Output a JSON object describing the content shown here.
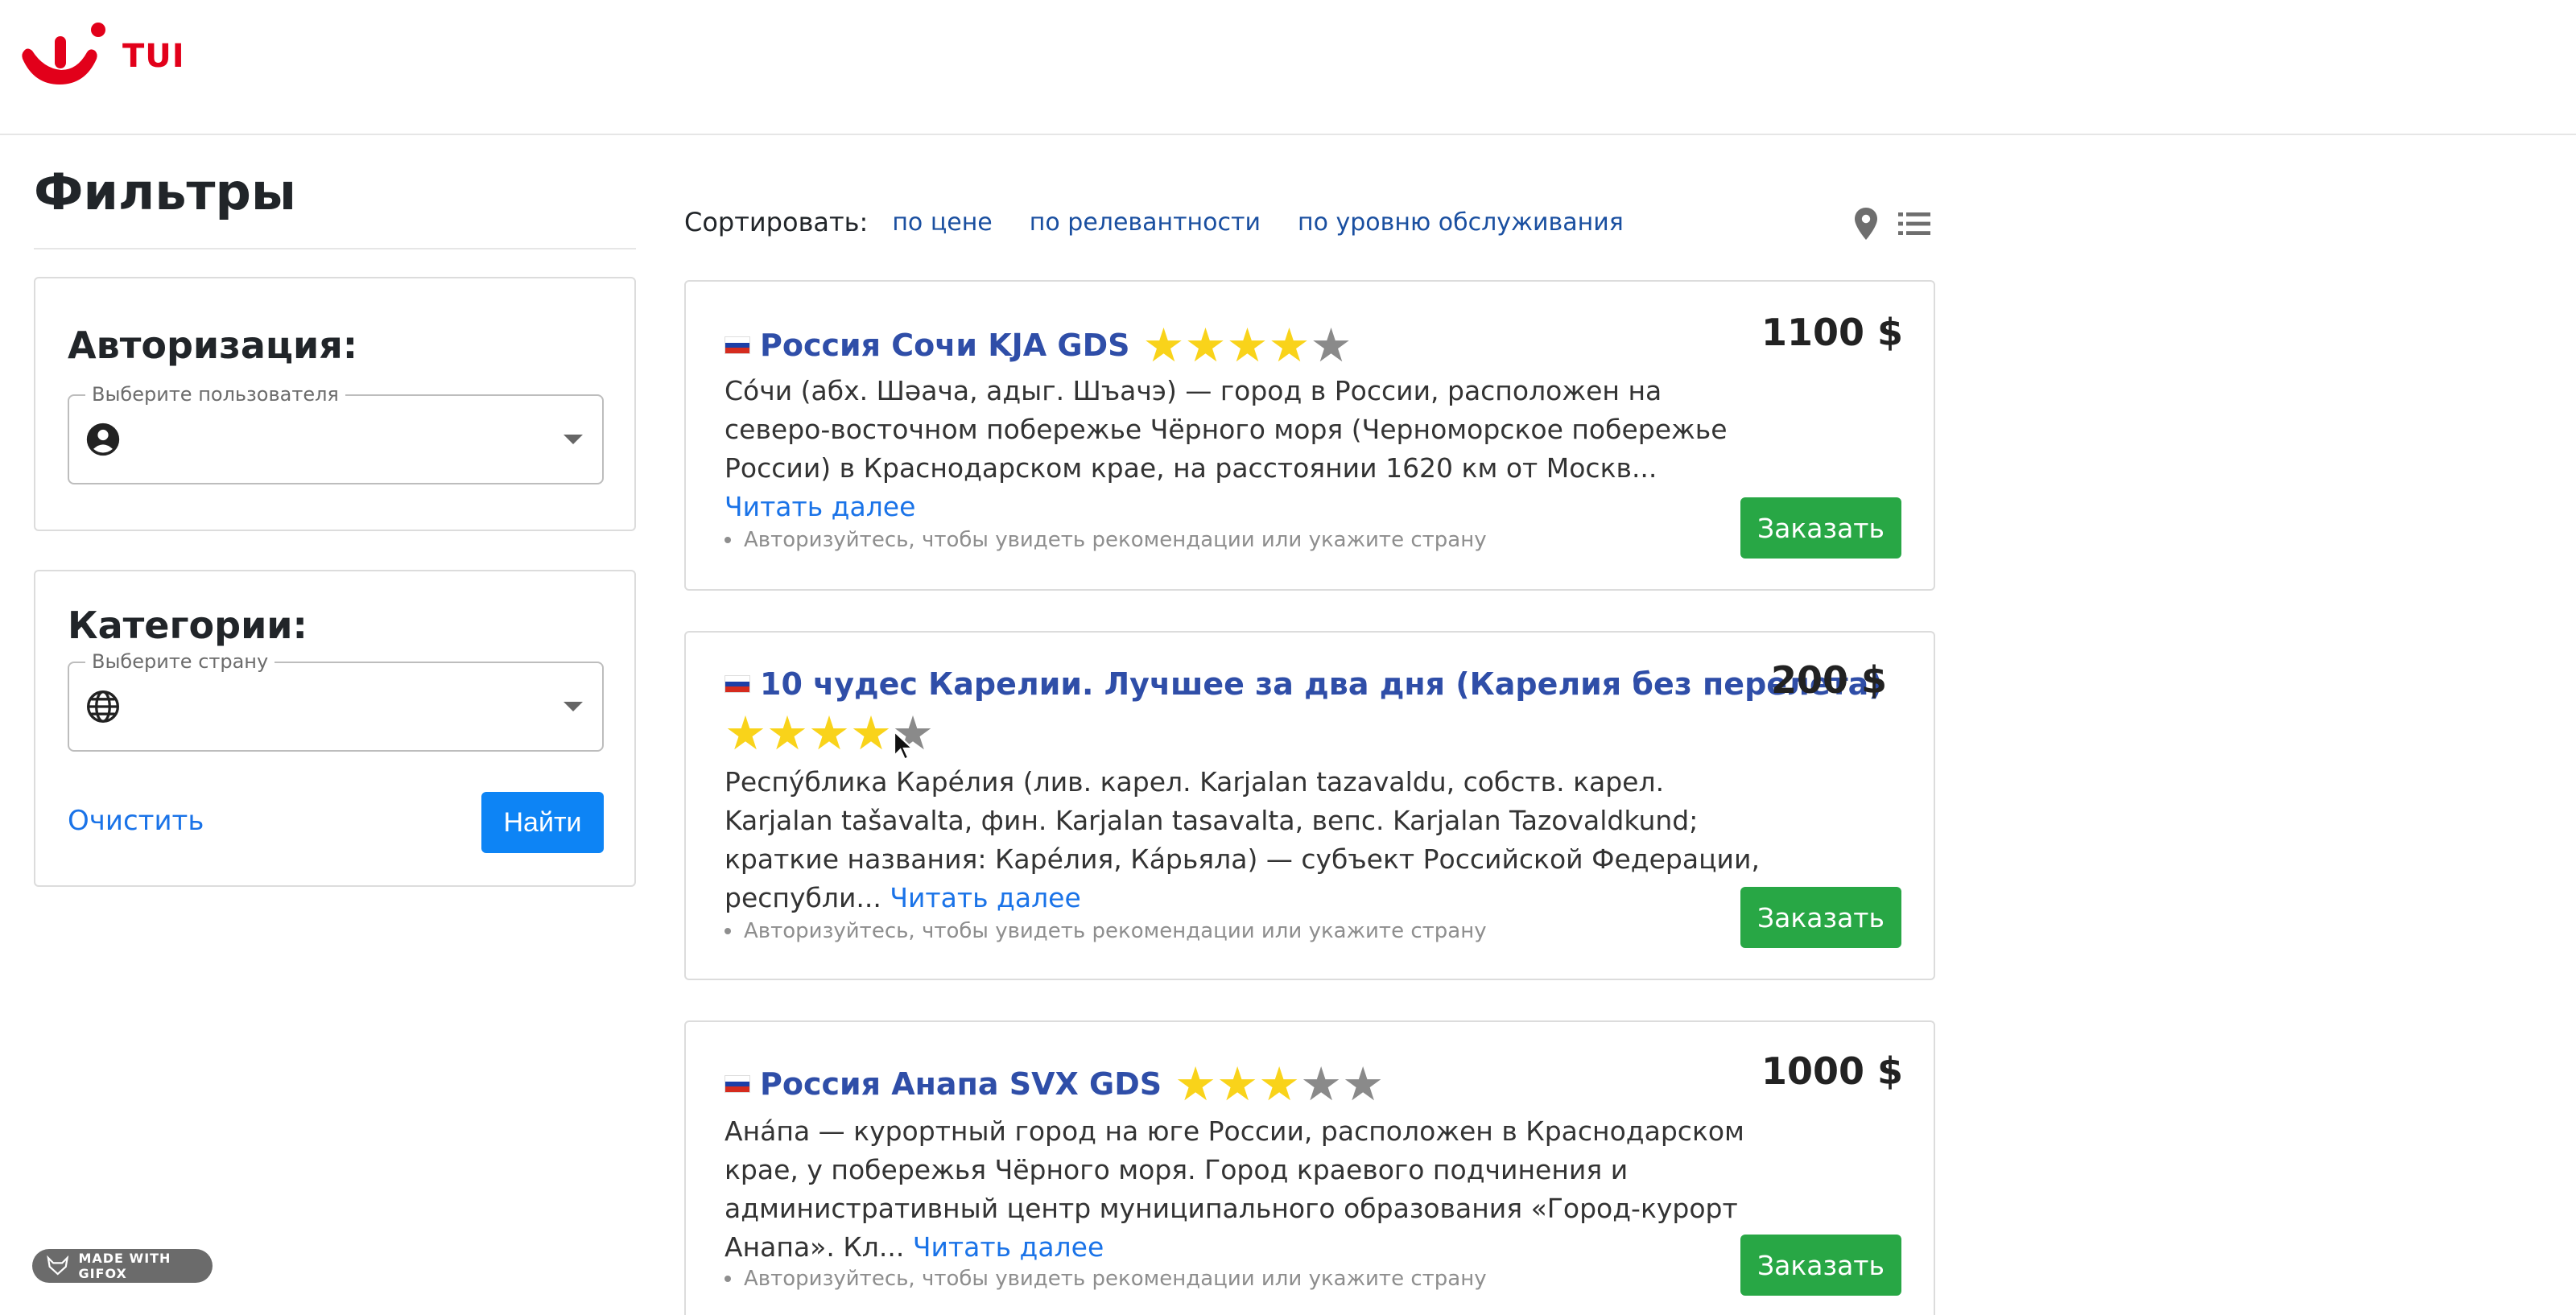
{
  "brand": {
    "logo_text": "TUI",
    "color": "#e2001a"
  },
  "filters": {
    "title": "Фильтры",
    "auth": {
      "heading": "Авторизация:",
      "select_label": "Выберите пользователя",
      "icon": "account-circle-icon"
    },
    "categories": {
      "heading": "Категории:",
      "select_label": "Выберите страну",
      "icon": "globe-icon"
    },
    "clear_label": "Очистить",
    "find_label": "Найти"
  },
  "sort": {
    "label": "Сортировать:",
    "options": [
      "по цене",
      "по релевантности",
      "по уровню обслуживания"
    ],
    "view_icons": [
      "map-pin-icon",
      "list-view-icon"
    ]
  },
  "tours": [
    {
      "title": "Россия Сочи KJA GDS",
      "rating": 4,
      "rating_max": 5,
      "price": "1100 $",
      "description": "Со́чи (абх. Шәача, адыг. Шъачэ) — город в России, расположен на северо-восточном побережье Чёрного моря (Черноморское побережье России) в Краснодарском крае, на расстоянии 1620 км от Москв...",
      "read_more": "Читать далее",
      "hint": "Авторизуйтесь, чтобы увидеть рекомендации или укажите страну",
      "order_label": "Заказать"
    },
    {
      "title": "10 чудес Карелии. Лучшее за два дня (Карелия без перелета)",
      "rating": 4,
      "rating_max": 5,
      "price": "200 $",
      "description": "Респу́блика Каре́лия (лив. карел. Karjalan tazavaldu, собств. карел. Karjalan tašavalta, фин. Karjalan tasavalta, вепс. Karjalan Tazovaldkund; краткие названия: Каре́лия, Ка́рьяла) — субъект Российской Федерации, республи...",
      "read_more": "Читать далее",
      "hint": "Авторизуйтесь, чтобы увидеть рекомендации или укажите страну",
      "order_label": "Заказать"
    },
    {
      "title": "Россия Анапа SVX GDS",
      "rating": 3,
      "rating_max": 5,
      "price": "1000 $",
      "description": "Ана́па — курортный город на юге России, расположен в Краснодарском крае, у побережья Чёрного моря. Город краевого подчинения и административный центр муниципального образования «Город-курорт Анапа». Кл...",
      "read_more": "Читать далее",
      "hint": "Авторизуйтесь, чтобы увидеть рекомендации или укажите страну",
      "order_label": "Заказать"
    }
  ],
  "badge": {
    "text": "MADE WITH GIFOX"
  },
  "colors": {
    "primary_button": "#0d84f5",
    "order_button": "#28a745",
    "link": "#1a73e8",
    "title": "#2f4ea8",
    "star_on": "#f9d31a",
    "star_off": "#8a8a8a"
  }
}
